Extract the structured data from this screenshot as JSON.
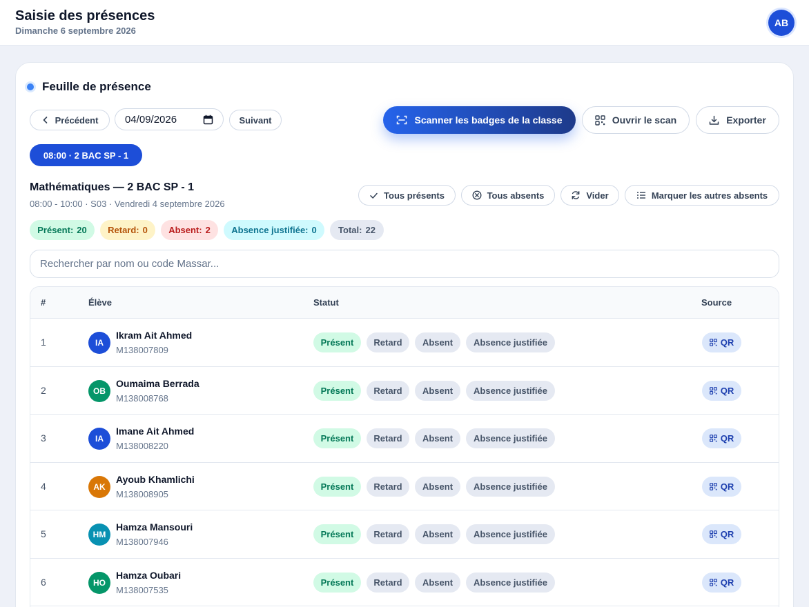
{
  "header": {
    "title": "Saisie des présences",
    "date": "Dimanche 6 septembre 2026",
    "user_initials": "AB"
  },
  "card": {
    "title": "Feuille de présence"
  },
  "nav": {
    "prev_label": "Précédent",
    "date_value": "04/09/2026",
    "next_label": "Suivant"
  },
  "actions": {
    "scan_class_label": "Scanner les badges de la classe",
    "open_scan_label": "Ouvrir le scan",
    "export_label": "Exporter"
  },
  "session_chip": "08:00 · 2 BAC SP - 1",
  "course": {
    "title": "Mathématiques — 2 BAC SP - 1",
    "subtitle": "08:00 - 10:00 · S03 · Vendredi 4 septembre 2026"
  },
  "bulk": {
    "all_present": "Tous présents",
    "all_absent": "Tous absents",
    "clear": "Vider",
    "mark_others_absent": "Marquer les autres absents"
  },
  "stats": [
    {
      "label": "Présent:",
      "value": "20",
      "bg": "#d1fae5",
      "fg": "#047857"
    },
    {
      "label": "Retard:",
      "value": "0",
      "bg": "#fef3c7",
      "fg": "#b45309"
    },
    {
      "label": "Absent:",
      "value": "2",
      "bg": "#fee2e2",
      "fg": "#b91c1c"
    },
    {
      "label": "Absence justifiée:",
      "value": "0",
      "bg": "#cffafe",
      "fg": "#0e7490"
    },
    {
      "label": "Total:",
      "value": "22",
      "bg": "#e5e9f2",
      "fg": "#475569"
    }
  ],
  "search": {
    "placeholder": "Rechercher par nom ou code Massar..."
  },
  "table": {
    "headers": {
      "idx": "#",
      "student": "Élève",
      "status": "Statut",
      "source": "Source"
    },
    "status_labels": {
      "present": "Présent",
      "late": "Retard",
      "absent": "Absent",
      "justified": "Absence justifiée"
    },
    "source_label": "QR",
    "rows": [
      {
        "idx": "1",
        "initials": "IA",
        "name": "Ikram Ait Ahmed",
        "code": "M138007809",
        "avatar_color": "#1d4ed8"
      },
      {
        "idx": "2",
        "initials": "OB",
        "name": "Oumaima Berrada",
        "code": "M138008768",
        "avatar_color": "#059669"
      },
      {
        "idx": "3",
        "initials": "IA",
        "name": "Imane Ait Ahmed",
        "code": "M138008220",
        "avatar_color": "#1d4ed8"
      },
      {
        "idx": "4",
        "initials": "AK",
        "name": "Ayoub Khamlichi",
        "code": "M138008905",
        "avatar_color": "#d97706"
      },
      {
        "idx": "5",
        "initials": "HM",
        "name": "Hamza Mansouri",
        "code": "M138007946",
        "avatar_color": "#0891b2"
      },
      {
        "idx": "6",
        "initials": "HO",
        "name": "Hamza Oubari",
        "code": "M138007535",
        "avatar_color": "#059669"
      }
    ]
  }
}
